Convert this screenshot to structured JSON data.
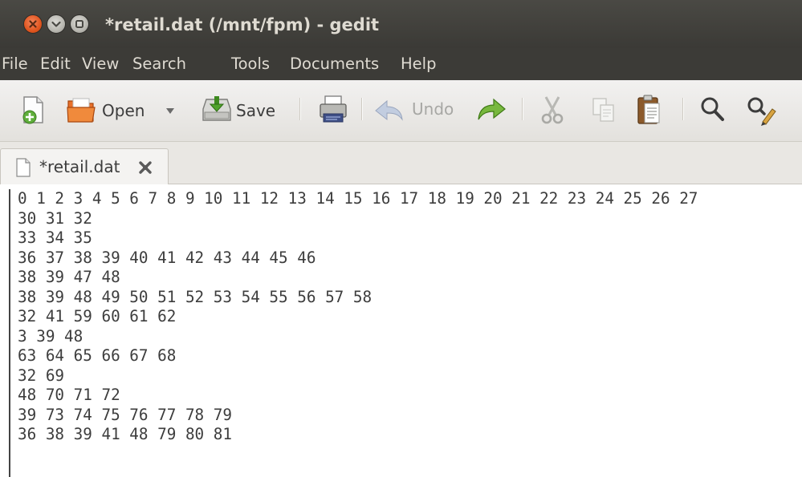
{
  "window": {
    "title": "*retail.dat (/mnt/fpm) - gedit",
    "title_bar_color": "#3c3b37",
    "close_button_color": "#e0551f"
  },
  "menubar": {
    "items": [
      "File",
      "Edit",
      "View",
      "Search",
      "Tools",
      "Documents",
      "Help"
    ]
  },
  "toolbar": {
    "new_icon": "new-document-icon",
    "open_label": "Open",
    "open_dropdown_icon": "chevron-down-icon",
    "save_label": "Save",
    "print_icon": "printer-icon",
    "undo_label": "Undo",
    "redo_icon": "redo-icon",
    "cut_icon": "scissors-icon",
    "copy_icon": "copy-icon",
    "paste_icon": "clipboard-icon",
    "find_icon": "search-icon",
    "replace_icon": "find-replace-icon"
  },
  "tab": {
    "label": "*retail.dat",
    "file_icon": "document-icon",
    "close_icon": "close-icon"
  },
  "editor": {
    "lines": [
      "0 1 2 3 4 5 6 7 8 9 10 11 12 13 14 15 16 17 18 19 20 21 22 23 24 25 26 27",
      "30 31 32",
      "33 34 35",
      "36 37 38 39 40 41 42 43 44 45 46",
      "38 39 47 48",
      "38 39 48 49 50 51 52 53 54 55 56 57 58",
      "32 41 59 60 61 62",
      "3 39 48",
      "63 64 65 66 67 68",
      "32 69",
      "48 70 71 72",
      "39 73 74 75 76 77 78 79",
      "36 38 39 41 48 79 80 81"
    ]
  }
}
